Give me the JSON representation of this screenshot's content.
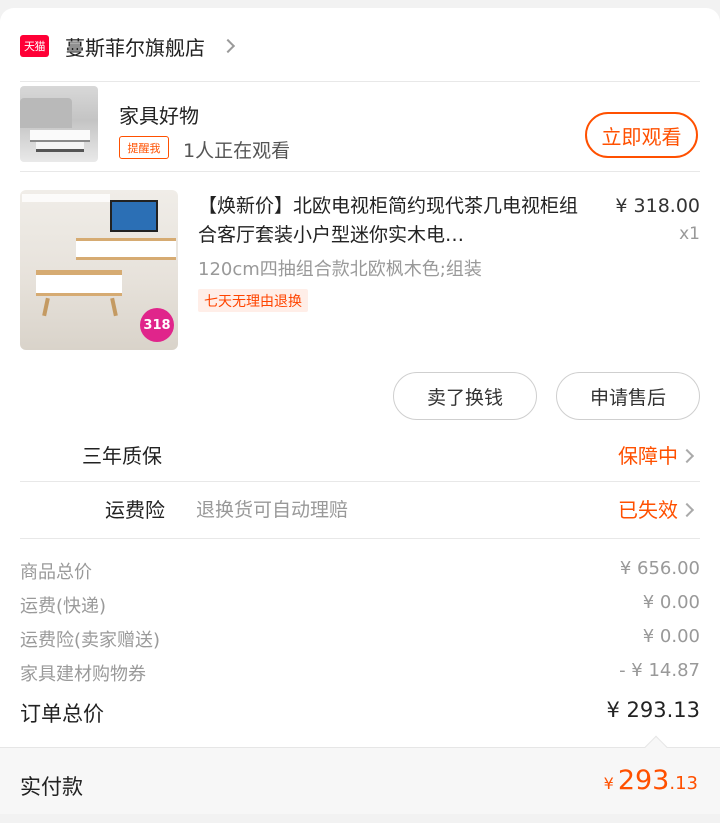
{
  "store": {
    "logo_text": "天猫",
    "name": "蔓斯菲尔旗舰店"
  },
  "live": {
    "title": "家具好物",
    "remind_label": "提醒我",
    "watching_text": "1人正在观看",
    "watch_button": "立即观看"
  },
  "product": {
    "title": "【焕新价】北欧电视柜简约现代茶几电视柜组合客厅套装小户型迷你实木电…",
    "price": "¥ 318.00",
    "quantity": "x1",
    "sku": "120cm四抽组合款北欧枫木色;组装",
    "policy": "七天无理由退换",
    "badge": "318",
    "sell_button": "卖了换钱",
    "aftersale_button": "申请售后"
  },
  "services": [
    {
      "label": "三年质保",
      "desc": "",
      "status": "保障中"
    },
    {
      "label": "运费险",
      "desc": "退换货可自动理赔",
      "status": "已失效"
    }
  ],
  "summary": [
    {
      "label": "商品总价",
      "value": "¥ 656.00"
    },
    {
      "label": "运费(快递)",
      "value": "¥ 0.00"
    },
    {
      "label": "运费险(卖家赠送)",
      "value": "¥ 0.00"
    },
    {
      "label": "家具建材购物券",
      "value": "- ¥ 14.87"
    }
  ],
  "order_total": {
    "label": "订单总价",
    "value": "¥ 293.13"
  },
  "paid": {
    "label": "实付款",
    "currency": "¥",
    "integer": "293",
    "decimal": ".13"
  },
  "colors": {
    "accent": "#ff5000",
    "tmall_red": "#ff0036",
    "muted_text": "#999999"
  }
}
